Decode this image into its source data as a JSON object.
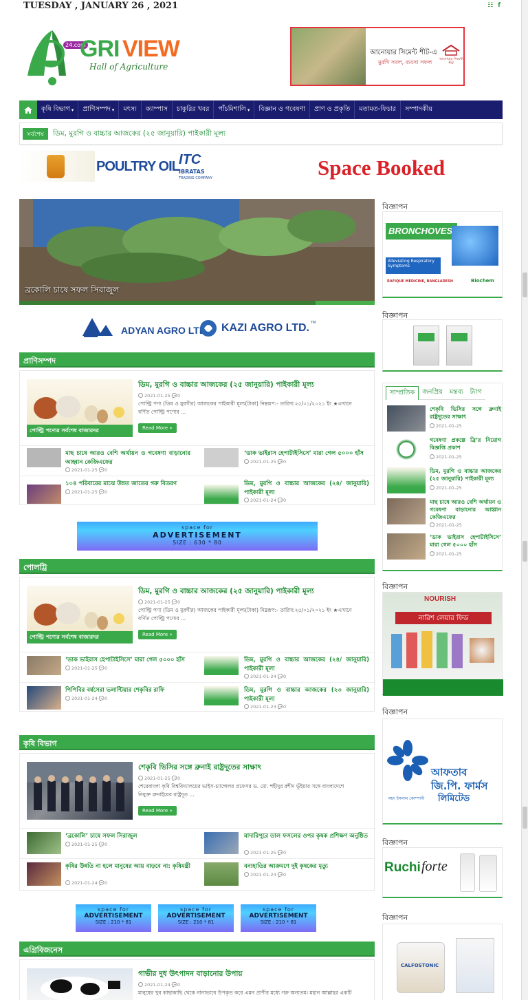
{
  "date": "TUESDAY , JANUARY 26 , 2021",
  "social_icons": [
    "rss-icon",
    "facebook-icon"
  ],
  "logo": {
    "main_a": "A",
    "main_rest": "RIVIEW",
    "grv": "GRI",
    "view": "VIEW",
    "badge": "24.com",
    "tagline": "Hall of Agriculture"
  },
  "header_ad": {
    "line1": "আনোয়ার সিমেন্ট শীট-এ",
    "line2": "মুরগি সবল, ব্যবসা সফল",
    "brand": "আনোয়ার সিমেন্ট শীট"
  },
  "nav": [
    {
      "label": "কৃষি বিভাগ",
      "dropdown": true
    },
    {
      "label": "প্রাণিসম্পদ",
      "dropdown": true
    },
    {
      "label": "মৎস্য",
      "dropdown": false
    },
    {
      "label": "ক্যাম্পাস",
      "dropdown": false
    },
    {
      "label": "চাকুরির খবর",
      "dropdown": false
    },
    {
      "label": "পাঁচমিশালি",
      "dropdown": true
    },
    {
      "label": "বিজ্ঞান ও গবেষণা",
      "dropdown": false
    },
    {
      "label": "প্রাণ ও প্রকৃতি",
      "dropdown": false
    },
    {
      "label": "মতামত-ফিচার",
      "dropdown": false
    },
    {
      "label": "সম্পাদকীয়",
      "dropdown": false
    }
  ],
  "breaking": {
    "tag": "সর্বশেষ",
    "text": "ডিম, মুরগি ও বাচ্চার আজকের (২৫ জানুয়ারি) পাইকারী মূল্য"
  },
  "ads": {
    "poultry_oil": "POULTRY OIL",
    "itc": "ITC",
    "itc_sub": "IBRATAS",
    "itc_sub2": "TRADING COMPANY",
    "space_booked": "Space Booked",
    "adyan": "ADYAN AGRO LTD.",
    "kazi": "KAZI AGRO LTD.",
    "kazi_tm": "TM"
  },
  "slider": {
    "caption": "ব্রকোলি চাষে সফল সিরাজুল"
  },
  "ad_banner_wide": {
    "l1": "space for",
    "l2": "ADVERTISEMENT",
    "l3": "SIZE : 630 * 80"
  },
  "ad_banner_small": {
    "l1": "space for",
    "l2": "ADVERTISEMENT",
    "l3": "SIZE : 210 * 81"
  },
  "feat_badge": "পোল্ট্রি পণ্যের সর্বশেষ বাজারদর",
  "read_more": "Read More »",
  "sections": [
    {
      "title": "প্রাণিসম্পদ",
      "feature": {
        "title": "ডিম, মুরগি ও বাচ্চার আজকের (২৫ জানুয়ারি) পাইকারী মূল্য",
        "date": "2021-01-25",
        "comments": "0",
        "excerpt1": "পোল্ট্রি পণ্য (ডিম ও মুরগীর) আজকের পাইকারী মূল্য(টাকা) নিম্নরূপ:- তারিখ:২৫/০১/২০২১ ইং ★এখানে",
        "excerpt2": "বর্ণিত পোল্ট্রি পণ্যের ..."
      },
      "items": [
        {
          "title": "মাছ চাষে আরও বেশি অর্থায়ন ও গবেষণা বাড়ানোর আহ্বান কেজিএফের",
          "date": "2021-01-25",
          "comments": "0"
        },
        {
          "title": "‘ডাক ভাইরাস হেপাটাইসিসে’ মারা গেল ৫০০০ হাঁস",
          "date": "2021-01-25",
          "comments": "0"
        },
        {
          "title": "১০৪ পরিবারের মাঝে উন্নত জাতের গরু বিতরণ",
          "date": "2021-01-25",
          "comments": "0"
        },
        {
          "title": "ডিম, মুরগি ও বাচ্চার আজকের (২৪/ জানুয়ারি) পাইকারী মূল্য",
          "date": "2021-01-24",
          "comments": "0"
        }
      ]
    },
    {
      "title": "পোলট্রি",
      "feature": {
        "title": "ডিম, মুরগি ও বাচ্চার আজকের (২৫ জানুয়ারি) পাইকারী মূল্য",
        "date": "2021-01-25",
        "comments": "0",
        "excerpt1": "পোল্ট্রি পণ্য (ডিম ও মুরগীর) আজকের পাইকারী মূল্য(টাকা) নিম্নরূপ:- তারিখ:২৫/০১/২০২১ ইং ★এখানে",
        "excerpt2": "বর্ণিত পোল্ট্রি পণ্যের ..."
      },
      "items": [
        {
          "title": "‘ডাক ভাইরাস হেপাটাইসিসে’ মারা গেল ৫০০০ হাঁস",
          "date": "2021-01-25",
          "comments": "0"
        },
        {
          "title": "ডিম, মুরগি ও বাচ্চার আজকের (২৪/ জানুয়ারি) পাইকারী মূল্য",
          "date": "2021-01-24",
          "comments": "0"
        },
        {
          "title": "পিপিবির বর্ষসেরা ভলান্টিয়ার শেকৃবির রাফি",
          "date": "2021-01-24",
          "comments": "0"
        },
        {
          "title": "ডিম, মুরগি ও বাচ্চার আজকের (২৩ জানুয়ারি) পাইকারী মূল্য",
          "date": "2021-01-23",
          "comments": "0"
        }
      ]
    },
    {
      "title": "কৃষি বিভাগ",
      "feature": {
        "title": "শেকৃবি ভিসির সঙ্গে ব্রুনাই রাষ্ট্রদূতের সাক্ষাৎ",
        "date": "2021-01-25",
        "comments": "0",
        "excerpt1": "শেরেবাংলা কৃষি বিশ্ববিদ্যালয়ের ভাইস-চ্যান্সেলর প্রফেসর ড. মো. শহীদুর রশীদ ভূঁইয়ার সঙ্গে বাংলাদেশে",
        "excerpt2": "নিযুক্ত ব্রুনাইয়ের রাষ্ট্রদূত ..."
      },
      "items": [
        {
          "title": "‘ব্রকোলি’ চাষে সফল সিরাজুল",
          "date": "2021-01-25",
          "comments": "0"
        },
        {
          "title": "মাদারিপুরে ডাল ফসলের ওপর কৃষক প্রশিক্ষণ অনুষ্ঠিত",
          "date": "2021-01-25",
          "comments": "0"
        },
        {
          "title": "কৃষির উন্নতি না হলে মানুষের আয় বাড়বে না: কৃষিমন্ত্রী",
          "date": "2021-01-24",
          "comments": "0"
        },
        {
          "title": "বন্যহাতির আক্রমণে দুই কৃষকের মৃত্যু",
          "date": "2021-01-24",
          "comments": "0"
        }
      ]
    },
    {
      "title": "এগ্রিবিজনেস",
      "feature": {
        "title": "গাভীর দুধ উৎপাদন বাড়ানোর উপায়",
        "date": "2021-01-24",
        "comments": "0",
        "excerpt1": "মানুষের খুব কাছাকাছি থেকে নানাভাবে উপকৃত করে এমন প্রাণীর মধ্যে গরু অন্যতম। মহান আল্লাহর একটি",
        "excerpt2": ""
      }
    }
  ],
  "sidebar": {
    "label": "বিজ্ঞাপন",
    "broncho": {
      "brand": "BRONCHOVEST",
      "sub": "Alleviating Respiratory Symptoms",
      "co": "RAFIQUE MEDICINE, BANGLADESH",
      "co2": "Biochem"
    },
    "nourish": {
      "brand": "NOURISH",
      "title": "নারিশ লেয়ার ফিড"
    },
    "aftab": {
      "l1": "আফতাব",
      "l2": "জি.পি. ফার্মস",
      "l3": "লিমিটেড",
      "l4": "মহৎ ইসলাম কোম্পানী"
    },
    "ruchi": {
      "brand": "Ruchi",
      "brand2": "forte"
    },
    "calfostonic": "CALFOSTONIC",
    "tabs": [
      {
        "label": "সাম্প্রতিক",
        "active": true
      },
      {
        "label": "জনপ্রিয়",
        "active": false
      },
      {
        "label": "মন্তব্য",
        "active": false
      },
      {
        "label": "ট্যাগ",
        "active": false
      }
    ],
    "recent": [
      {
        "title": "শেকৃবি ভিসির সঙ্গে ব্রুনাই রাষ্ট্রদূতের সাক্ষাৎ",
        "date": "2021-01-25"
      },
      {
        "title": "গবেষণা প্রকল্পে ব্রি’র নিয়োগ বিজ্ঞপ্তি প্রকাশ",
        "date": "2021-01-25"
      },
      {
        "title": "ডিম, মুরগি ও বাচ্চার আজকের (২৫ জানুয়ারি) পাইকারী মূল্য",
        "date": "2021-01-25"
      },
      {
        "title": "মাছ চাষে আরও বেশি অর্থায়ন ও গবেষণা বাড়ানোর আহ্বান কেজিএফের",
        "date": "2021-01-25"
      },
      {
        "title": "‘ডাক ভাইরাস হেপাটাইসিসে’ মারা গেল ৫০০০ হাঁস",
        "date": "2021-01-25"
      }
    ]
  }
}
